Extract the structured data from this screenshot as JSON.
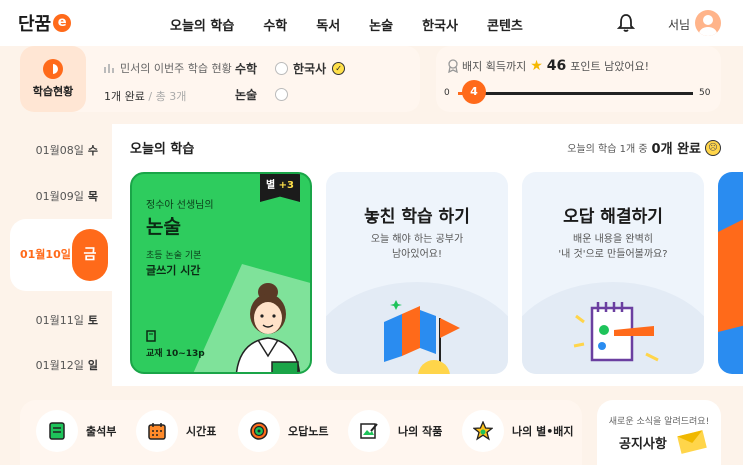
{
  "header": {
    "logo": "단꿈",
    "logo_mark": "e",
    "nav": [
      "오늘의 학습",
      "수학",
      "독서",
      "논술",
      "한국사",
      "콘텐츠"
    ],
    "user_name": "서님"
  },
  "weekly_status": {
    "panel_label": "학습현황",
    "title": "민서의 이번주 학습 현황",
    "done": "1개 완료",
    "separator": "/",
    "total": "총 3개",
    "subjects": [
      {
        "name": "수학",
        "completed": false
      },
      {
        "name": "한국사",
        "completed": true
      },
      {
        "name": "논술",
        "completed": false
      }
    ]
  },
  "badge_progress": {
    "text_before": "배지 획득까지",
    "points": "46",
    "text_after": "포인트 남았어요!",
    "min": "0",
    "max": "50",
    "current": "4",
    "progress_fraction": 0.08
  },
  "dates": [
    {
      "date": "01월08일",
      "dow": "수"
    },
    {
      "date": "01월09일",
      "dow": "목"
    },
    {
      "date": "01월10일",
      "dow": "금",
      "active": true
    },
    {
      "date": "01월11일",
      "dow": "토"
    },
    {
      "date": "01월12일",
      "dow": "일"
    }
  ],
  "today": {
    "title": "오늘의 학습",
    "summary_prefix": "오늘의 학습 1개 중",
    "summary_done": "0개 완료",
    "lesson_card": {
      "teacher": "정수아 선생님의",
      "subject": "논술",
      "course": "초등 논술 기본",
      "lesson": "글쓰기 시간",
      "book": "교재 10~13p",
      "star_label": "별",
      "star_value": "+3"
    },
    "missed_card": {
      "title": "놓친 학습 하기",
      "desc_line1": "오늘 해야 하는 공부가",
      "desc_line2": "남아있어요!"
    },
    "review_card": {
      "title": "오답 해결하기",
      "desc_line1": "배운 내용을 완벽히",
      "desc_line2": "'내 것'으로 만들어볼까요?"
    }
  },
  "bottom_menu": [
    {
      "label": "출석부",
      "icon": "attendance-icon"
    },
    {
      "label": "시간표",
      "icon": "calendar-icon"
    },
    {
      "label": "오답노트",
      "icon": "target-icon"
    },
    {
      "label": "나의 작품",
      "icon": "artwork-icon"
    },
    {
      "label": "나의 별•배지",
      "icon": "star-badge-icon"
    }
  ],
  "notice": {
    "subtitle": "새로운 소식을 알려드려요!",
    "title": "공지사항"
  },
  "colors": {
    "accent": "#ff6a1a",
    "lesson_card": "#2ecc5e",
    "background": "#fdf3ea"
  }
}
